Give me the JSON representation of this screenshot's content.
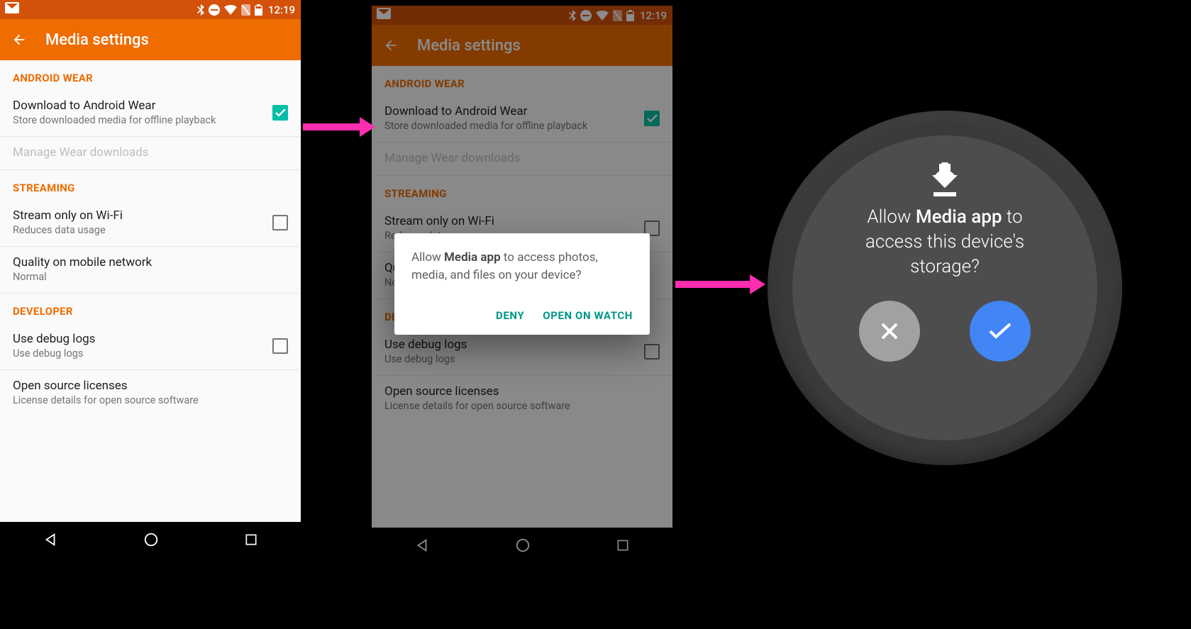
{
  "status": {
    "time": "12:19"
  },
  "appbar": {
    "title": "Media settings"
  },
  "sections": {
    "wear": {
      "header": "ANDROID WEAR",
      "download": {
        "title": "Download to Android Wear",
        "sub": "Store downloaded media for offline playback",
        "checked": true
      },
      "manage": {
        "title": "Manage Wear downloads"
      }
    },
    "streaming": {
      "header": "STREAMING",
      "wifi": {
        "title": "Stream only on Wi-Fi",
        "sub": "Reduces data usage",
        "checked": false
      },
      "quality": {
        "title": "Quality on mobile network",
        "sub": "Normal"
      }
    },
    "developer": {
      "header": "DEVELOPER",
      "debug": {
        "title": "Use debug logs",
        "sub": "Use debug logs",
        "checked": false
      },
      "licenses": {
        "title": "Open source licenses",
        "sub": "License details for open source software"
      }
    }
  },
  "dialog": {
    "prefix": "Allow ",
    "app": "Media app",
    "suffix": " to access photos, media, and files on your device?",
    "deny": "DENY",
    "open": "OPEN ON WATCH"
  },
  "watch": {
    "prefix": "Allow ",
    "app": "Media app",
    "suffix1": "  to",
    "line2": "access this device's",
    "line3": "storage?"
  }
}
